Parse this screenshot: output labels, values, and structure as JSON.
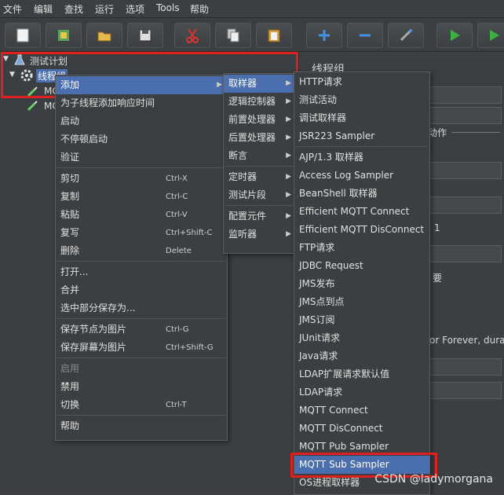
{
  "menubar": [
    "文件",
    "编辑",
    "查找",
    "运行",
    "选项",
    "Tools",
    "帮助"
  ],
  "toolbar_icons": [
    "new-icon",
    "templates-icon",
    "open-icon",
    "save-icon",
    "cut-icon",
    "copy-icon",
    "paste-icon",
    "expand-icon",
    "collapse-icon",
    "toggle-icon",
    "start-icon",
    "start-no-pause-icon"
  ],
  "tree": {
    "root": "测试计划",
    "thread_group": "线程组",
    "child1": "MC",
    "child2": "MC"
  },
  "right_pane": {
    "title": "线程组",
    "action_label": "动作",
    "frag1": "1",
    "frag2": "要",
    "frag3": "or Forever, durati"
  },
  "context_menu": {
    "items": [
      {
        "label": "添加",
        "shortcut": "",
        "arrow": true,
        "selected": true
      },
      {
        "label": "为子线程添加响应时间",
        "shortcut": ""
      },
      {
        "label": "启动",
        "shortcut": ""
      },
      {
        "label": "不停顿启动",
        "shortcut": ""
      },
      {
        "label": "验证",
        "shortcut": ""
      },
      {
        "label": "剪切",
        "shortcut": "Ctrl-X"
      },
      {
        "label": "复制",
        "shortcut": "Ctrl-C"
      },
      {
        "label": "粘贴",
        "shortcut": "Ctrl-V"
      },
      {
        "label": "复写",
        "shortcut": "Ctrl+Shift-C"
      },
      {
        "label": "删除",
        "shortcut": "Delete"
      },
      {
        "label": "打开...",
        "shortcut": ""
      },
      {
        "label": "合并",
        "shortcut": ""
      },
      {
        "label": "选中部分保存为...",
        "shortcut": ""
      },
      {
        "label": "保存节点为图片",
        "shortcut": "Ctrl-G"
      },
      {
        "label": "保存屏幕为图片",
        "shortcut": "Ctrl+Shift-G"
      },
      {
        "label": "启用",
        "shortcut": "",
        "disabled": true
      },
      {
        "label": "禁用",
        "shortcut": ""
      },
      {
        "label": "切换",
        "shortcut": "Ctrl-T"
      },
      {
        "label": "帮助",
        "shortcut": ""
      }
    ]
  },
  "add_submenu": {
    "items": [
      {
        "label": "取样器",
        "selected": true
      },
      {
        "label": "逻辑控制器"
      },
      {
        "label": "前置处理器"
      },
      {
        "label": "后置处理器"
      },
      {
        "label": "断言"
      },
      {
        "label": "定时器"
      },
      {
        "label": "测试片段"
      },
      {
        "label": "配置元件"
      },
      {
        "label": "监听器"
      }
    ]
  },
  "sampler_submenu": {
    "items": [
      "HTTP请求",
      "测试活动",
      "调试取样器",
      "JSR223 Sampler",
      "AJP/1.3 取样器",
      "Access Log Sampler",
      "BeanShell 取样器",
      "Efficient MQTT Connect",
      "Efficient MQTT DisConnect",
      "FTP请求",
      "JDBC Request",
      "JMS发布",
      "JMS点到点",
      "JMS订阅",
      "JUnit请求",
      "Java请求",
      "LDAP扩展请求默认值",
      "LDAP请求",
      "MQTT Connect",
      "MQTT DisConnect",
      "MQTT Pub Sampler",
      "MQTT Sub Sampler",
      "OS进程取样器"
    ],
    "selected_index": 21
  },
  "watermark": "CSDN @ladymorgana",
  "colors": {
    "highlight": "#4b6eaf",
    "bg": "#3c3f41",
    "red": "#e02020"
  }
}
